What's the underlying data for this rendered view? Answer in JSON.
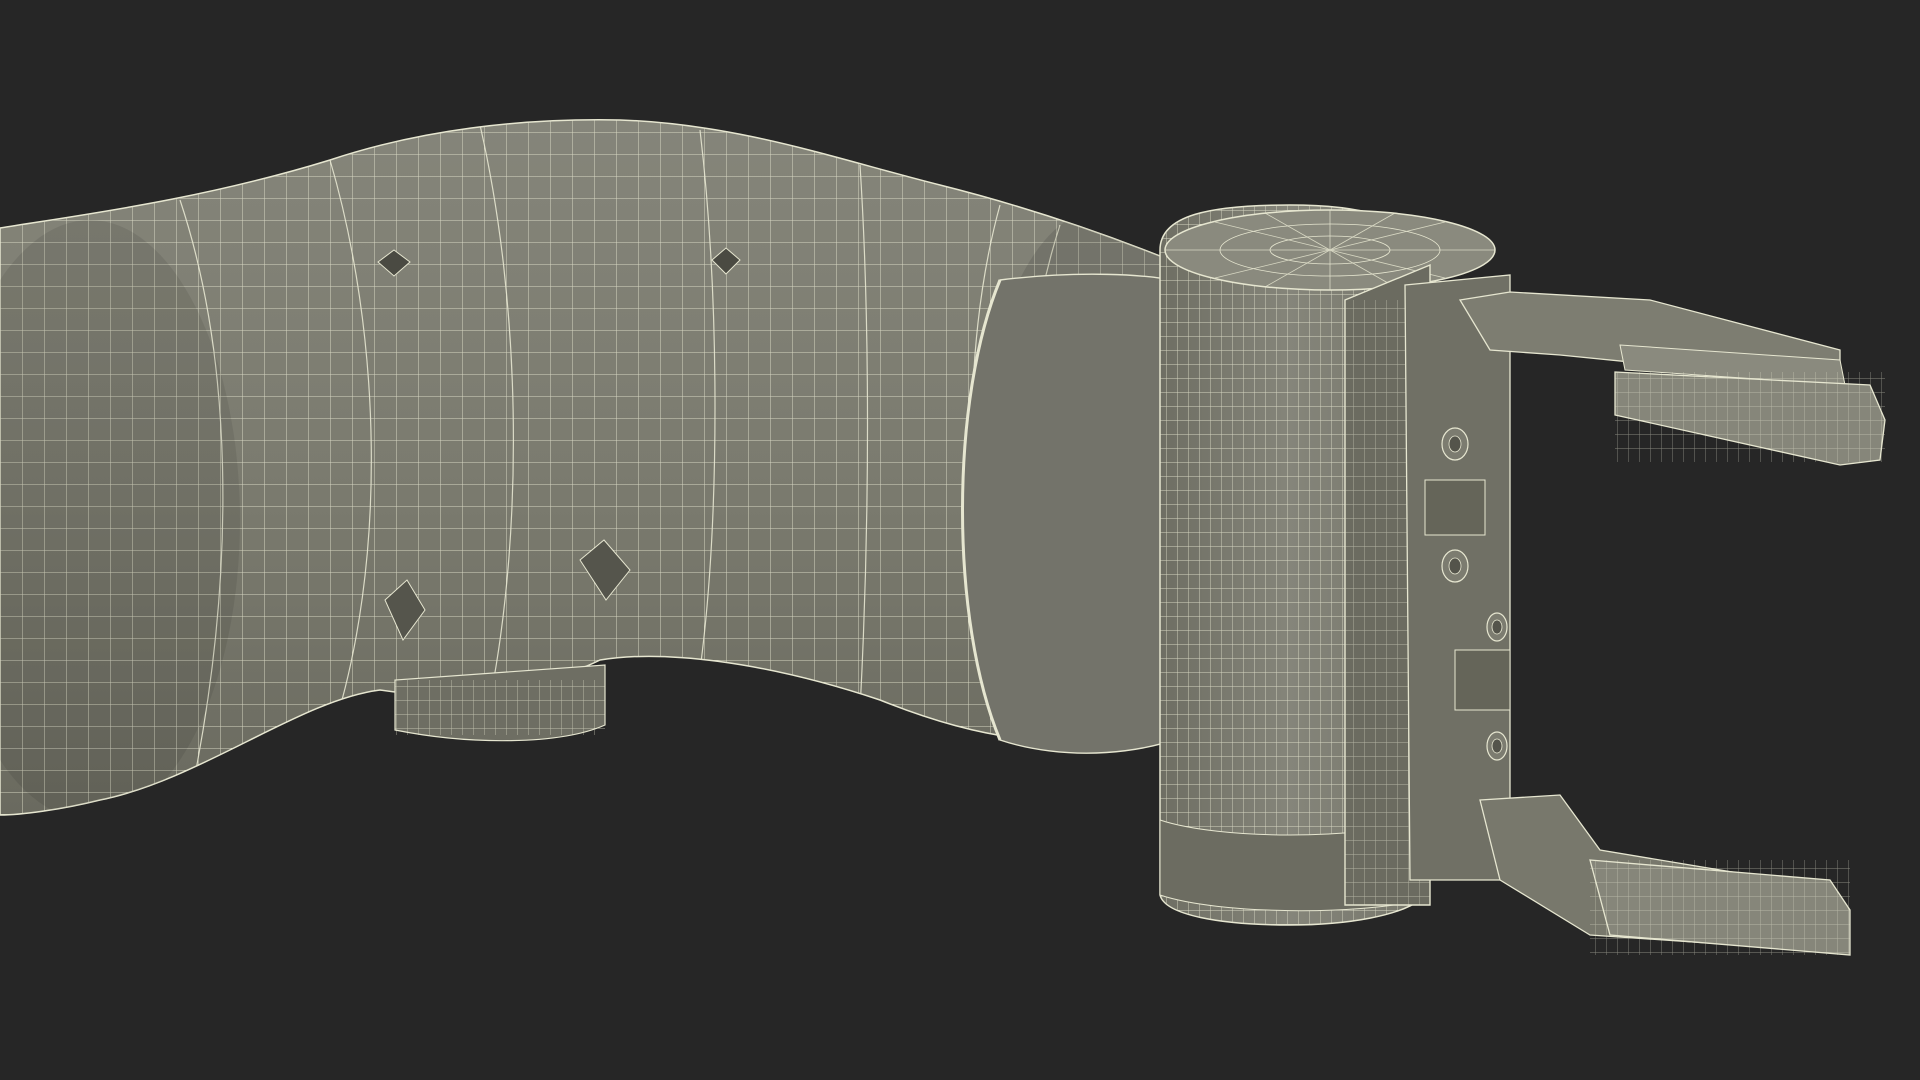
{
  "scene": {
    "subject": "robot-arm-wireframe",
    "colors": {
      "background": "#262626",
      "surface": "#79796c",
      "surface_light": "#868677",
      "surface_dark": "#5f5f55",
      "wire": "#e6e6d0",
      "edge_dark": "#34342f"
    }
  }
}
